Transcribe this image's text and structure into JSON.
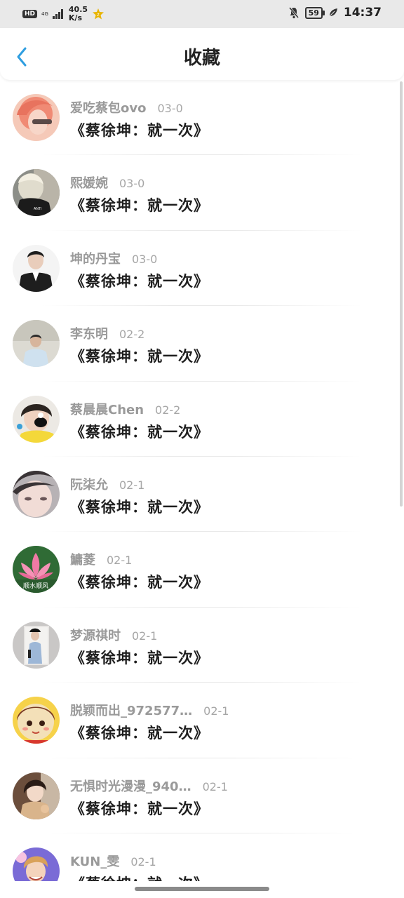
{
  "status_bar": {
    "hd": "HD",
    "network": "4G",
    "speed_value": "40.5",
    "speed_unit": "K/s",
    "battery": "59",
    "time": "14:37"
  },
  "header": {
    "back_icon": "chevron-left-icon",
    "title": "收藏"
  },
  "accent_color": "#2f9ee0",
  "items": [
    {
      "name": "爱吃蔡包ovo",
      "date": "03-0",
      "title": "《蔡徐坤：就一次》"
    },
    {
      "name": "熙媛婉",
      "date": "03-0",
      "title": "《蔡徐坤：就一次》"
    },
    {
      "name": "坤的丹宝",
      "date": "03-0",
      "title": "《蔡徐坤：就一次》"
    },
    {
      "name": "李东明",
      "date": "02-2",
      "title": "《蔡徐坤：就一次》"
    },
    {
      "name": "蔡晨晨Chen",
      "date": "02-2",
      "title": "《蔡徐坤：就一次》"
    },
    {
      "name": "阮柒允",
      "date": "02-1",
      "title": "《蔡徐坤：就一次》"
    },
    {
      "name": "鱅菱",
      "date": "02-1",
      "title": "《蔡徐坤：就一次》"
    },
    {
      "name": "梦源祺时",
      "date": "02-1",
      "title": "《蔡徐坤：就一次》"
    },
    {
      "name": "脱颖而出_972577…",
      "date": "02-1",
      "title": "《蔡徐坤：就一次》"
    },
    {
      "name": "无惧时光漫漫_940…",
      "date": "02-1",
      "title": "《蔡徐坤：就一次》"
    },
    {
      "name": "KUN_雯",
      "date": "02-1",
      "title": "《蔡徐坤：就一次》"
    }
  ],
  "avatar_7_caption": "顺水顺风"
}
